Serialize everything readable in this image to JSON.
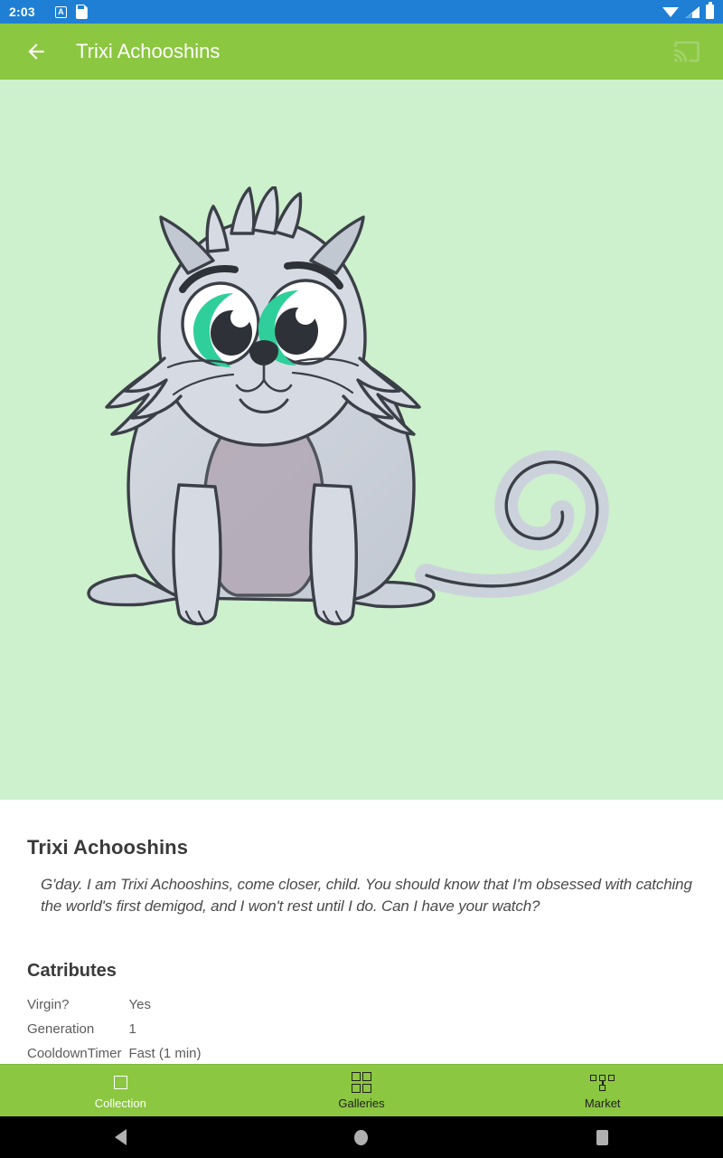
{
  "status_bar": {
    "clock": "2:03",
    "icons": [
      "alarm-a-badge-icon",
      "sd-card-icon",
      "wifi-icon",
      "cellular-signal-icon",
      "battery-icon"
    ],
    "background_color": "#1e7fd4"
  },
  "app_bar": {
    "title": "Trixi Achooshins",
    "back_icon": "arrow-left-icon",
    "cast_icon": "cast-icon",
    "background_color": "#8bc740"
  },
  "hero": {
    "background_color": "#cdf0cd",
    "artwork": "cryptokitty-cat-illustration",
    "fur_color": "#ccd2db",
    "belly_color": "#b3a8b5",
    "eye_color": "#2ecf9a",
    "outline_color": "#3b3f47"
  },
  "details": {
    "kitty_name": "Trixi Achooshins",
    "bio": "G'day. I am Trixi Achooshins, come closer, child. You should know that I'm obsessed with catching the world's first demigod, and I won't rest until I do. Can I have your watch?",
    "catributes_heading": "Catributes",
    "catributes": [
      {
        "key": "Virgin?",
        "value": "Yes"
      },
      {
        "key": "Generation",
        "value": "1"
      },
      {
        "key": "CooldownTimer",
        "value": "Fast (1 min)"
      }
    ]
  },
  "bottom_nav": {
    "items": [
      {
        "label": "Collection",
        "icon": "single-square-icon",
        "active": true
      },
      {
        "label": "Galleries",
        "icon": "grid-four-squares-icon",
        "active": false
      },
      {
        "label": "Market",
        "icon": "hierarchy-tree-icon",
        "active": false
      }
    ],
    "background_color": "#8bc740",
    "active_color": "#ffffff",
    "inactive_color": "#21201f"
  },
  "system_nav": {
    "buttons": [
      "back-triangle-icon",
      "home-circle-icon",
      "recents-square-icon"
    ],
    "background_color": "#000000"
  }
}
